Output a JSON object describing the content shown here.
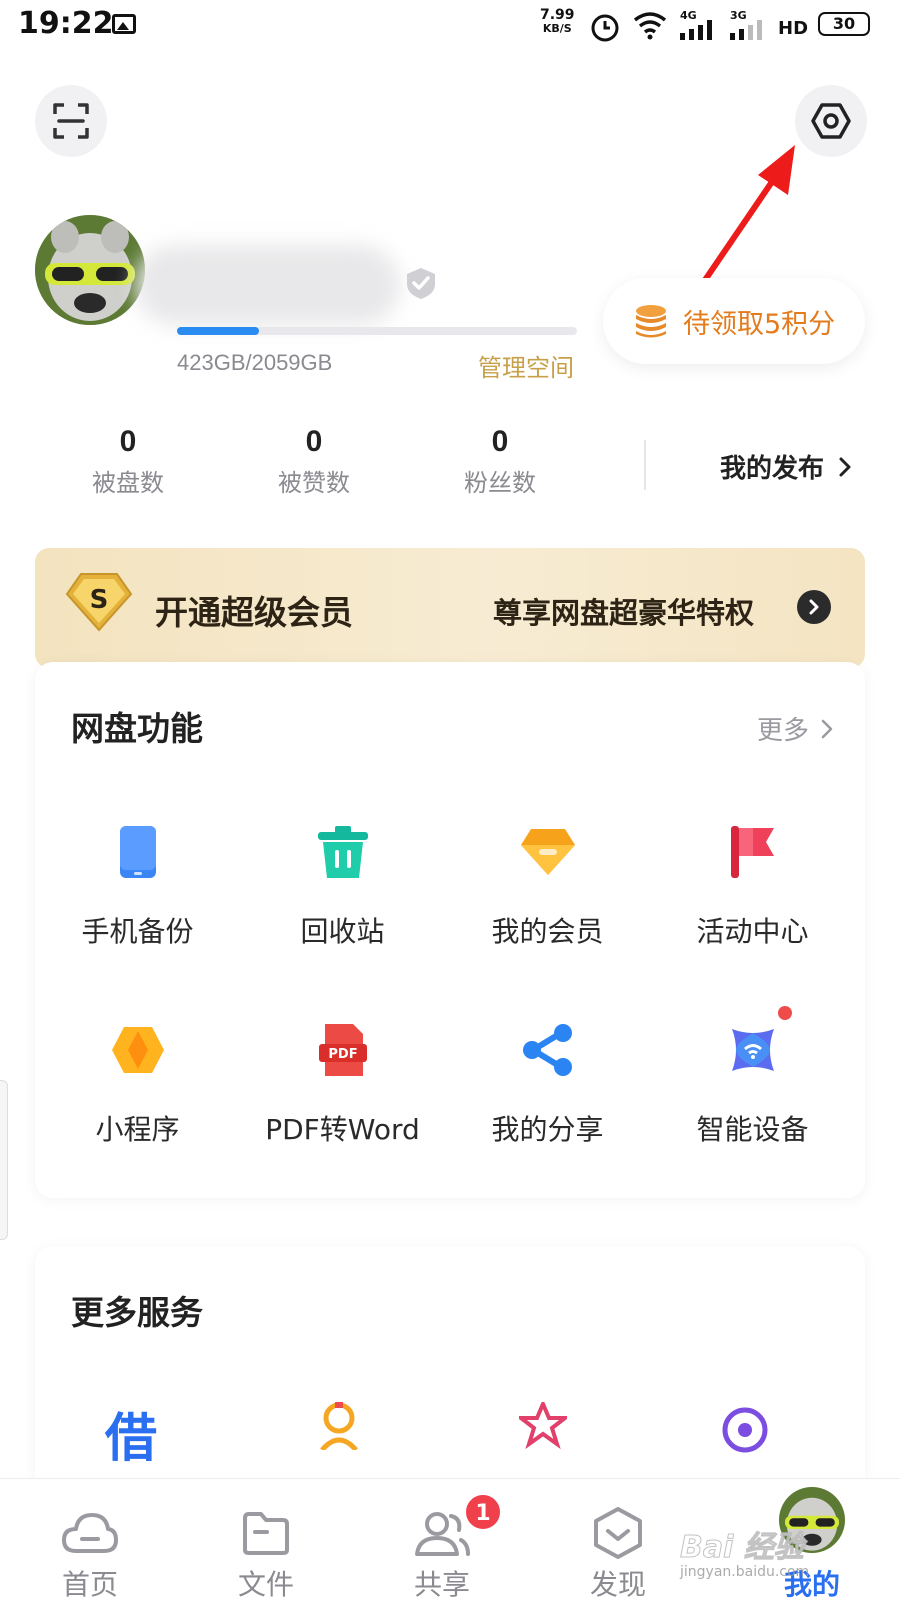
{
  "status_bar": {
    "time": "19:22",
    "net_speed_value": "7.99",
    "net_speed_unit": "KB/S",
    "sim1": "4G",
    "sim2": "3G",
    "hd": "HD",
    "battery": "30"
  },
  "header": {
    "scan_icon": "scan-icon",
    "settings_icon": "settings-hexagon-icon"
  },
  "profile": {
    "storage_progress": 0.205,
    "storage_text": "423GB/2059GB",
    "manage_space": "管理空间",
    "points_label": "待领取5积分"
  },
  "stats": [
    {
      "value": "0",
      "label": "被盘数"
    },
    {
      "value": "0",
      "label": "被赞数"
    },
    {
      "value": "0",
      "label": "粉丝数"
    }
  ],
  "my_publish": "我的发布",
  "vip_banner": {
    "badge": "S",
    "title": "开通超级会员",
    "subtitle": "尊享网盘超豪华特权"
  },
  "features_card": {
    "title": "网盘功能",
    "more": "更多",
    "items": [
      {
        "label": "手机备份",
        "icon": "phone-backup-icon",
        "color": "#3a86f7"
      },
      {
        "label": "回收站",
        "icon": "trash-icon",
        "color": "#14b89c"
      },
      {
        "label": "我的会员",
        "icon": "vip-diamond-icon",
        "color": "#f7a21b"
      },
      {
        "label": "活动中心",
        "icon": "flag-icon",
        "color": "#f0415a"
      },
      {
        "label": "小程序",
        "icon": "mini-program-icon",
        "color": "#ffb41f"
      },
      {
        "label": "PDF转Word",
        "icon": "pdf-icon",
        "color": "#ec4a45"
      },
      {
        "label": "我的分享",
        "icon": "share-icon",
        "color": "#2a84f2"
      },
      {
        "label": "智能设备",
        "icon": "smart-device-icon",
        "color": "#5b6cf0"
      }
    ]
  },
  "services_card": {
    "title": "更多服务",
    "partial_glyph": "借"
  },
  "tabbar": {
    "tabs": [
      {
        "label": "首页",
        "icon": "cloud-icon"
      },
      {
        "label": "文件",
        "icon": "folder-icon"
      },
      {
        "label": "共享",
        "icon": "people-icon",
        "badge": "1"
      },
      {
        "label": "发现",
        "icon": "discover-icon"
      },
      {
        "label": "我的",
        "icon": "avatar-icon",
        "active": true
      }
    ]
  },
  "watermark": {
    "main": "Bai 经验",
    "sub": "jingyan.baidu.com"
  },
  "colors": {
    "accent_blue": "#2a6ff0",
    "gold": "#c8a04a",
    "orange": "#e47b1c",
    "badge_red": "#f0404c"
  }
}
